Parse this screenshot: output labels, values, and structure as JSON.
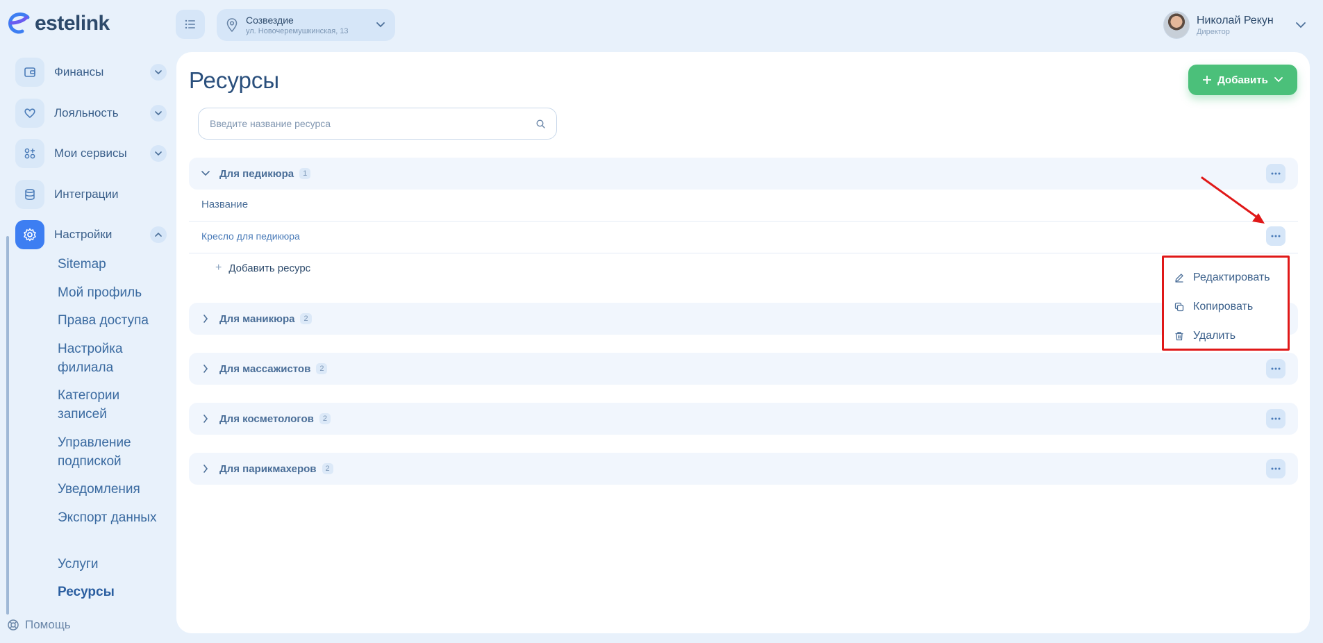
{
  "app": {
    "logo_text": "estelink"
  },
  "header": {
    "branch": {
      "name": "Созвездие",
      "address": "ул. Новочеремушкинская, 13"
    },
    "user": {
      "name": "Николай Рекун",
      "role": "Директор"
    }
  },
  "sidebar": {
    "items": [
      {
        "label": "Финансы",
        "icon": "wallet-icon"
      },
      {
        "label": "Лояльность",
        "icon": "heart-icon"
      },
      {
        "label": "Мои сервисы",
        "icon": "grid-plus-icon"
      },
      {
        "label": "Интеграции",
        "icon": "database-icon"
      },
      {
        "label": "Настройки",
        "icon": "gear-icon"
      }
    ],
    "settings_sub": [
      "Sitemap",
      "Мой профиль",
      "Права доступа",
      "Настройка филиала",
      "Категории записей",
      "Управление подпиской",
      "Уведомления",
      "Экспорт данных",
      "Услуги",
      "Ресурсы"
    ],
    "help_label": "Помощь"
  },
  "main": {
    "title": "Ресурсы",
    "add_button": "Добавить",
    "search_placeholder": "Введите название ресурса",
    "groups": [
      {
        "name": "Для педикюра",
        "count": "1"
      },
      {
        "name": "Для маникюра",
        "count": "2"
      },
      {
        "name": "Для массажистов",
        "count": "2"
      },
      {
        "name": "Для косметологов",
        "count": "2"
      },
      {
        "name": "Для парикмахеров",
        "count": "2"
      }
    ],
    "column_name": "Название",
    "resource_item": "Кресло для педикюра",
    "add_resource": "Добавить ресурс"
  },
  "context_menu": {
    "items": [
      {
        "label": "Редактировать",
        "icon": "pencil-icon"
      },
      {
        "label": "Копировать",
        "icon": "copy-icon"
      },
      {
        "label": "Удалить",
        "icon": "trash-icon"
      }
    ]
  },
  "colors": {
    "accent": "#3d7ef2",
    "add_button": "#4bc07a",
    "highlight": "#e01818",
    "background": "#e8f1fb"
  }
}
